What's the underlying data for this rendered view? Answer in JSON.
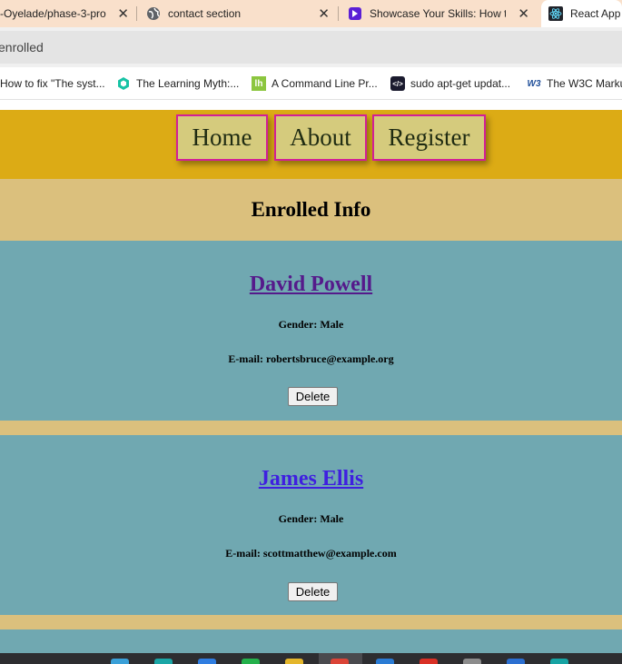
{
  "browser": {
    "tabs": [
      {
        "title": "-Oyelade/phase-3-pro",
        "close": "✕"
      },
      {
        "title": "contact section",
        "close": "✕"
      },
      {
        "title": "Showcase Your Skills: How to",
        "close": "✕"
      },
      {
        "title": "React App"
      }
    ],
    "address": "enrolled",
    "bookmarks": [
      {
        "label": "How to fix \"The syst..."
      },
      {
        "label": "The Learning Myth:..."
      },
      {
        "label": "A Command Line Pr...",
        "icon_text": "lh"
      },
      {
        "label": "sudo apt-get updat...",
        "icon_text": "</>"
      },
      {
        "label": "The W3C Marku",
        "icon_text": "W3"
      }
    ]
  },
  "nav": {
    "home": "Home",
    "about": "About",
    "register": "Register"
  },
  "page": {
    "heading": "Enrolled Info"
  },
  "students": [
    {
      "name": "David Powell",
      "gender": "Gender: Male",
      "email": "E-mail: robertsbruce@example.org",
      "delete": "Delete",
      "name_color": "#551a8b"
    },
    {
      "name": "James Ellis",
      "gender": "Gender: Male",
      "email": "E-mail: scottmatthew@example.com",
      "delete": "Delete",
      "name_color": "#3f1fe0"
    }
  ],
  "colors": {
    "navbar": "#dcab15",
    "nav_button": "#d5cb7d",
    "nav_border": "#d21f97",
    "page_bg": "#dbc07d",
    "card": "#70a8b1",
    "tab_strip": "#f9e0cb"
  }
}
